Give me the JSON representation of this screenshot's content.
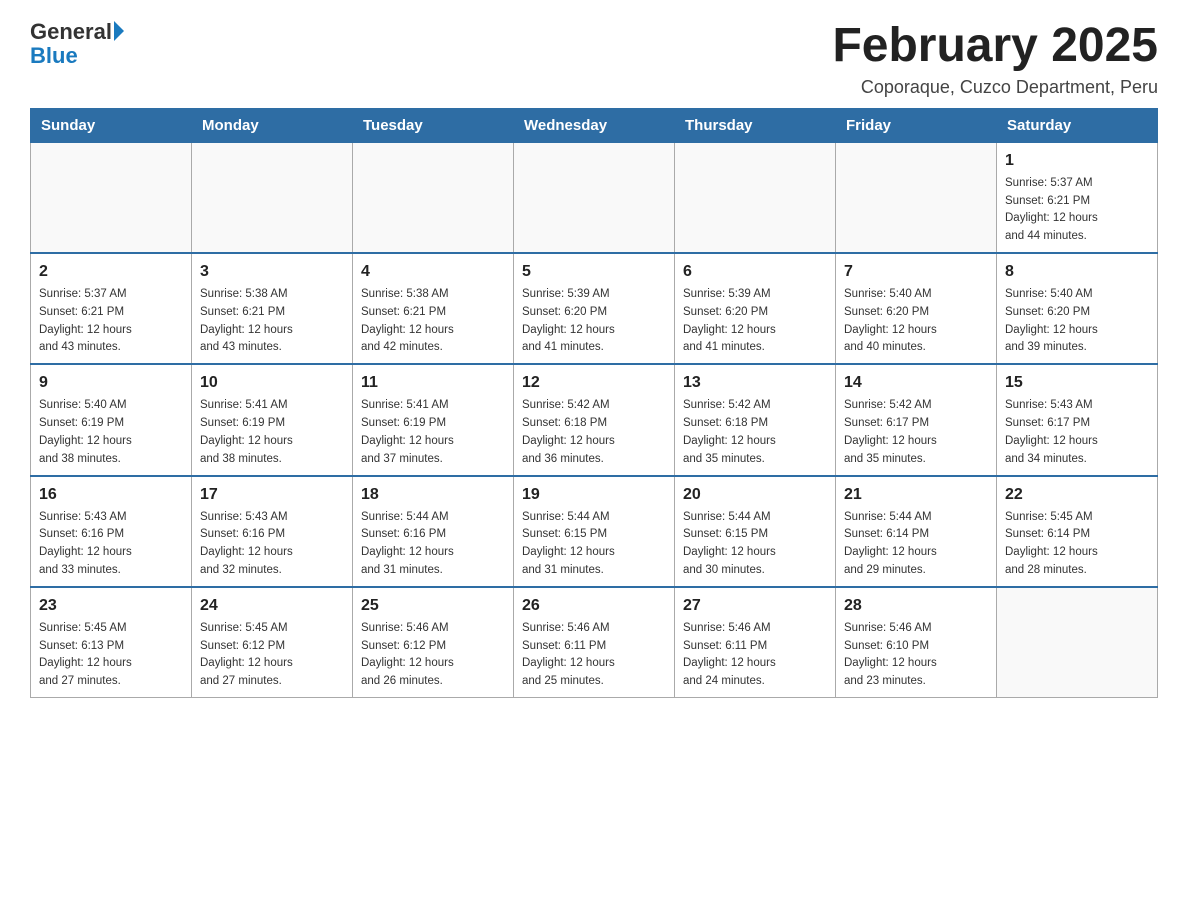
{
  "header": {
    "logo_general": "General",
    "logo_blue": "Blue",
    "title": "February 2025",
    "subtitle": "Coporaque, Cuzco Department, Peru"
  },
  "weekdays": [
    "Sunday",
    "Monday",
    "Tuesday",
    "Wednesday",
    "Thursday",
    "Friday",
    "Saturday"
  ],
  "weeks": [
    [
      {
        "day": "",
        "info": ""
      },
      {
        "day": "",
        "info": ""
      },
      {
        "day": "",
        "info": ""
      },
      {
        "day": "",
        "info": ""
      },
      {
        "day": "",
        "info": ""
      },
      {
        "day": "",
        "info": ""
      },
      {
        "day": "1",
        "info": "Sunrise: 5:37 AM\nSunset: 6:21 PM\nDaylight: 12 hours\nand 44 minutes."
      }
    ],
    [
      {
        "day": "2",
        "info": "Sunrise: 5:37 AM\nSunset: 6:21 PM\nDaylight: 12 hours\nand 43 minutes."
      },
      {
        "day": "3",
        "info": "Sunrise: 5:38 AM\nSunset: 6:21 PM\nDaylight: 12 hours\nand 43 minutes."
      },
      {
        "day": "4",
        "info": "Sunrise: 5:38 AM\nSunset: 6:21 PM\nDaylight: 12 hours\nand 42 minutes."
      },
      {
        "day": "5",
        "info": "Sunrise: 5:39 AM\nSunset: 6:20 PM\nDaylight: 12 hours\nand 41 minutes."
      },
      {
        "day": "6",
        "info": "Sunrise: 5:39 AM\nSunset: 6:20 PM\nDaylight: 12 hours\nand 41 minutes."
      },
      {
        "day": "7",
        "info": "Sunrise: 5:40 AM\nSunset: 6:20 PM\nDaylight: 12 hours\nand 40 minutes."
      },
      {
        "day": "8",
        "info": "Sunrise: 5:40 AM\nSunset: 6:20 PM\nDaylight: 12 hours\nand 39 minutes."
      }
    ],
    [
      {
        "day": "9",
        "info": "Sunrise: 5:40 AM\nSunset: 6:19 PM\nDaylight: 12 hours\nand 38 minutes."
      },
      {
        "day": "10",
        "info": "Sunrise: 5:41 AM\nSunset: 6:19 PM\nDaylight: 12 hours\nand 38 minutes."
      },
      {
        "day": "11",
        "info": "Sunrise: 5:41 AM\nSunset: 6:19 PM\nDaylight: 12 hours\nand 37 minutes."
      },
      {
        "day": "12",
        "info": "Sunrise: 5:42 AM\nSunset: 6:18 PM\nDaylight: 12 hours\nand 36 minutes."
      },
      {
        "day": "13",
        "info": "Sunrise: 5:42 AM\nSunset: 6:18 PM\nDaylight: 12 hours\nand 35 minutes."
      },
      {
        "day": "14",
        "info": "Sunrise: 5:42 AM\nSunset: 6:17 PM\nDaylight: 12 hours\nand 35 minutes."
      },
      {
        "day": "15",
        "info": "Sunrise: 5:43 AM\nSunset: 6:17 PM\nDaylight: 12 hours\nand 34 minutes."
      }
    ],
    [
      {
        "day": "16",
        "info": "Sunrise: 5:43 AM\nSunset: 6:16 PM\nDaylight: 12 hours\nand 33 minutes."
      },
      {
        "day": "17",
        "info": "Sunrise: 5:43 AM\nSunset: 6:16 PM\nDaylight: 12 hours\nand 32 minutes."
      },
      {
        "day": "18",
        "info": "Sunrise: 5:44 AM\nSunset: 6:16 PM\nDaylight: 12 hours\nand 31 minutes."
      },
      {
        "day": "19",
        "info": "Sunrise: 5:44 AM\nSunset: 6:15 PM\nDaylight: 12 hours\nand 31 minutes."
      },
      {
        "day": "20",
        "info": "Sunrise: 5:44 AM\nSunset: 6:15 PM\nDaylight: 12 hours\nand 30 minutes."
      },
      {
        "day": "21",
        "info": "Sunrise: 5:44 AM\nSunset: 6:14 PM\nDaylight: 12 hours\nand 29 minutes."
      },
      {
        "day": "22",
        "info": "Sunrise: 5:45 AM\nSunset: 6:14 PM\nDaylight: 12 hours\nand 28 minutes."
      }
    ],
    [
      {
        "day": "23",
        "info": "Sunrise: 5:45 AM\nSunset: 6:13 PM\nDaylight: 12 hours\nand 27 minutes."
      },
      {
        "day": "24",
        "info": "Sunrise: 5:45 AM\nSunset: 6:12 PM\nDaylight: 12 hours\nand 27 minutes."
      },
      {
        "day": "25",
        "info": "Sunrise: 5:46 AM\nSunset: 6:12 PM\nDaylight: 12 hours\nand 26 minutes."
      },
      {
        "day": "26",
        "info": "Sunrise: 5:46 AM\nSunset: 6:11 PM\nDaylight: 12 hours\nand 25 minutes."
      },
      {
        "day": "27",
        "info": "Sunrise: 5:46 AM\nSunset: 6:11 PM\nDaylight: 12 hours\nand 24 minutes."
      },
      {
        "day": "28",
        "info": "Sunrise: 5:46 AM\nSunset: 6:10 PM\nDaylight: 12 hours\nand 23 minutes."
      },
      {
        "day": "",
        "info": ""
      }
    ]
  ]
}
